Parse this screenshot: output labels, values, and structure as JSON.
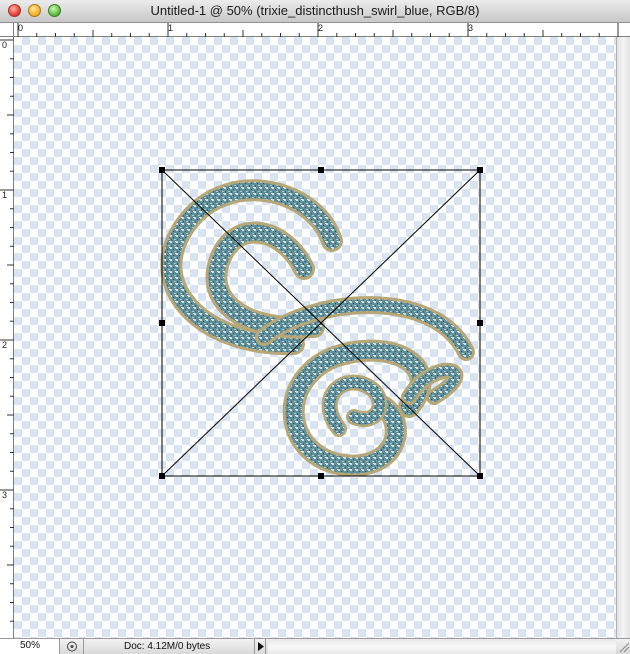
{
  "window": {
    "title": "Untitled-1 @ 50% (trixie_distincthush_swirl_blue, RGB/8)"
  },
  "rulers": {
    "horizontal_labels": [
      "0",
      "1",
      "2",
      "3"
    ],
    "vertical_labels": [
      "0",
      "1",
      "2",
      "3"
    ]
  },
  "status": {
    "zoom": "50%",
    "doc_info": "Doc: 4.12M/0 bytes"
  },
  "icons": {
    "close": "close-icon",
    "minimize": "minimize-icon",
    "zoom": "zoom-icon",
    "status_menu": "triangle-right-icon",
    "preview": "preview-icon"
  },
  "colors": {
    "swirl_fill": "#5f8f9a",
    "swirl_edge": "#b7a777",
    "checker": "#d8e4f2"
  }
}
